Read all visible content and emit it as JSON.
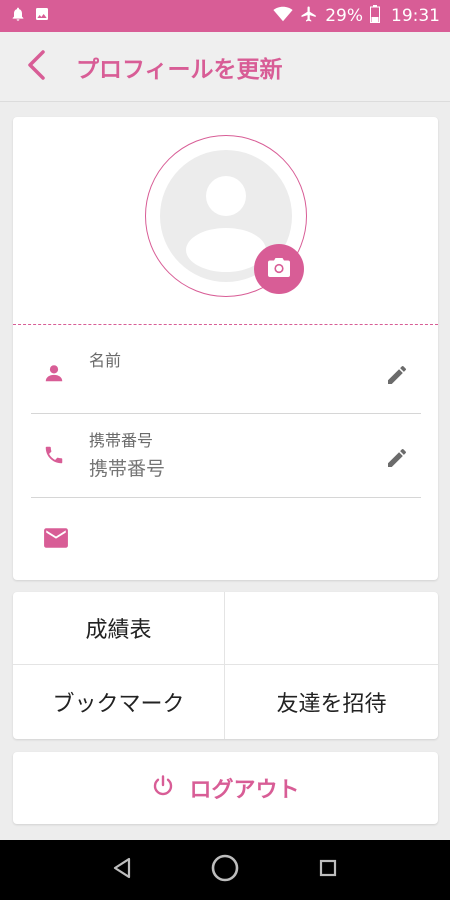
{
  "status_bar": {
    "battery": "29%",
    "time": "19:31",
    "icons": [
      "notification-bell-icon",
      "image-icon",
      "wifi-icon",
      "airplane-icon",
      "battery-icon"
    ]
  },
  "header": {
    "title": "プロフィールを更新",
    "back_icon": "chevron-left-icon"
  },
  "profile": {
    "avatar_icon": "person-placeholder-icon",
    "camera_icon": "camera-icon",
    "fields": {
      "name": {
        "label": "名前",
        "value": ""
      },
      "phone": {
        "label": "携帯番号",
        "value": "携帯番号"
      },
      "email": {
        "label": "",
        "value": ""
      }
    }
  },
  "menu": {
    "items": [
      "成績表",
      "",
      "ブックマーク",
      "友達を招待"
    ]
  },
  "logout": {
    "label": "ログアウト",
    "icon": "power-icon"
  },
  "nav": {
    "icons": [
      "back-triangle-icon",
      "home-circle-icon",
      "recents-square-icon"
    ]
  },
  "colors": {
    "accent": "#d85d96",
    "background": "#ededed",
    "card": "#ffffff",
    "nav_bar": "#000000"
  }
}
